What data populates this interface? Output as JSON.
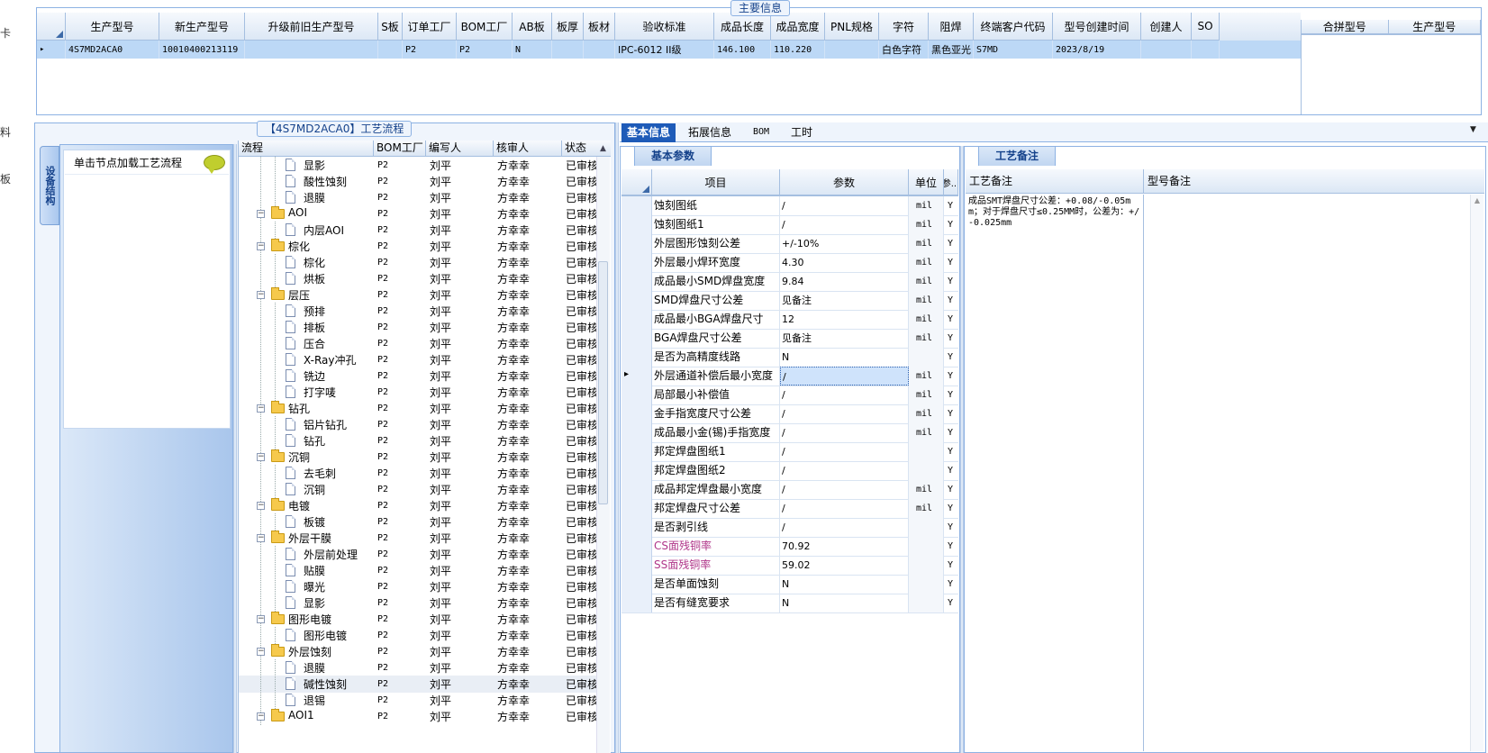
{
  "left_clipped": [
    "卡",
    "料",
    "板"
  ],
  "main": {
    "caption": "主要信息",
    "columns": [
      "生产型号",
      "新生产型号",
      "升级前旧生产型号",
      "S板",
      "订单工厂",
      "BOM工厂",
      "AB板",
      "板厚",
      "板材",
      "验收标准",
      "成品长度",
      "成品宽度",
      "PNL规格",
      "字符",
      "阻焊",
      "终端客户代码",
      "型号创建时间",
      "创建人",
      "SO"
    ],
    "row": {
      "marker": "▸",
      "cells": [
        "4S7MD2ACA0",
        "10010400213119",
        "",
        "",
        "P2",
        "P2",
        "N",
        "",
        "",
        "IPC-6012 II级",
        "146.100",
        "110.220",
        "",
        "白色字符",
        "黑色亚光",
        "S7MD",
        "2023/8/19",
        "",
        ""
      ]
    },
    "merge_columns": [
      "合拼型号",
      "生产型号"
    ]
  },
  "process": {
    "caption": "【4S7MD2ACA0】工艺流程",
    "side_tab": "设备结构",
    "side_item": "单击节点加载工艺流程",
    "columns": [
      "流程",
      "BOM工厂",
      "编写人",
      "核审人",
      "状态"
    ],
    "rows": [
      {
        "label": "显影",
        "level": 2,
        "type": "doc",
        "factory": "P2",
        "writer": "刘平",
        "reviewer": "方幸幸",
        "status": "已审核"
      },
      {
        "label": "酸性蚀刻",
        "level": 2,
        "type": "doc",
        "factory": "P2",
        "writer": "刘平",
        "reviewer": "方幸幸",
        "status": "已审核"
      },
      {
        "label": "退膜",
        "level": 2,
        "type": "doc",
        "factory": "P2",
        "writer": "刘平",
        "reviewer": "方幸幸",
        "status": "已审核"
      },
      {
        "label": "AOI",
        "level": 1,
        "type": "folder",
        "factory": "P2",
        "writer": "刘平",
        "reviewer": "方幸幸",
        "status": "已审核"
      },
      {
        "label": "内层AOI",
        "level": 2,
        "type": "doc",
        "factory": "P2",
        "writer": "刘平",
        "reviewer": "方幸幸",
        "status": "已审核"
      },
      {
        "label": "棕化",
        "level": 1,
        "type": "folder",
        "factory": "P2",
        "writer": "刘平",
        "reviewer": "方幸幸",
        "status": "已审核"
      },
      {
        "label": "棕化",
        "level": 2,
        "type": "doc",
        "factory": "P2",
        "writer": "刘平",
        "reviewer": "方幸幸",
        "status": "已审核"
      },
      {
        "label": "烘板",
        "level": 2,
        "type": "doc",
        "factory": "P2",
        "writer": "刘平",
        "reviewer": "方幸幸",
        "status": "已审核"
      },
      {
        "label": "层压",
        "level": 1,
        "type": "folder",
        "factory": "P2",
        "writer": "刘平",
        "reviewer": "方幸幸",
        "status": "已审核"
      },
      {
        "label": "预排",
        "level": 2,
        "type": "doc",
        "factory": "P2",
        "writer": "刘平",
        "reviewer": "方幸幸",
        "status": "已审核"
      },
      {
        "label": "排板",
        "level": 2,
        "type": "doc",
        "factory": "P2",
        "writer": "刘平",
        "reviewer": "方幸幸",
        "status": "已审核"
      },
      {
        "label": "压合",
        "level": 2,
        "type": "doc",
        "factory": "P2",
        "writer": "刘平",
        "reviewer": "方幸幸",
        "status": "已审核"
      },
      {
        "label": "X-Ray冲孔",
        "level": 2,
        "type": "doc",
        "factory": "P2",
        "writer": "刘平",
        "reviewer": "方幸幸",
        "status": "已审核"
      },
      {
        "label": "铣边",
        "level": 2,
        "type": "doc",
        "factory": "P2",
        "writer": "刘平",
        "reviewer": "方幸幸",
        "status": "已审核"
      },
      {
        "label": "打字唛",
        "level": 2,
        "type": "doc",
        "factory": "P2",
        "writer": "刘平",
        "reviewer": "方幸幸",
        "status": "已审核"
      },
      {
        "label": "钻孔",
        "level": 1,
        "type": "folder",
        "factory": "P2",
        "writer": "刘平",
        "reviewer": "方幸幸",
        "status": "已审核"
      },
      {
        "label": "铝片钻孔",
        "level": 2,
        "type": "doc",
        "factory": "P2",
        "writer": "刘平",
        "reviewer": "方幸幸",
        "status": "已审核"
      },
      {
        "label": "钻孔",
        "level": 2,
        "type": "doc",
        "factory": "P2",
        "writer": "刘平",
        "reviewer": "方幸幸",
        "status": "已审核"
      },
      {
        "label": "沉铜",
        "level": 1,
        "type": "folder",
        "factory": "P2",
        "writer": "刘平",
        "reviewer": "方幸幸",
        "status": "已审核"
      },
      {
        "label": "去毛刺",
        "level": 2,
        "type": "doc",
        "factory": "P2",
        "writer": "刘平",
        "reviewer": "方幸幸",
        "status": "已审核"
      },
      {
        "label": "沉铜",
        "level": 2,
        "type": "doc",
        "factory": "P2",
        "writer": "刘平",
        "reviewer": "方幸幸",
        "status": "已审核"
      },
      {
        "label": "电镀",
        "level": 1,
        "type": "folder",
        "factory": "P2",
        "writer": "刘平",
        "reviewer": "方幸幸",
        "status": "已审核"
      },
      {
        "label": "板镀",
        "level": 2,
        "type": "doc",
        "factory": "P2",
        "writer": "刘平",
        "reviewer": "方幸幸",
        "status": "已审核"
      },
      {
        "label": "外层干膜",
        "level": 1,
        "type": "folder",
        "factory": "P2",
        "writer": "刘平",
        "reviewer": "方幸幸",
        "status": "已审核"
      },
      {
        "label": "外层前处理",
        "level": 2,
        "type": "doc",
        "factory": "P2",
        "writer": "刘平",
        "reviewer": "方幸幸",
        "status": "已审核"
      },
      {
        "label": "贴膜",
        "level": 2,
        "type": "doc",
        "factory": "P2",
        "writer": "刘平",
        "reviewer": "方幸幸",
        "status": "已审核"
      },
      {
        "label": "曝光",
        "level": 2,
        "type": "doc",
        "factory": "P2",
        "writer": "刘平",
        "reviewer": "方幸幸",
        "status": "已审核"
      },
      {
        "label": "显影",
        "level": 2,
        "type": "doc",
        "factory": "P2",
        "writer": "刘平",
        "reviewer": "方幸幸",
        "status": "已审核"
      },
      {
        "label": "图形电镀",
        "level": 1,
        "type": "folder",
        "factory": "P2",
        "writer": "刘平",
        "reviewer": "方幸幸",
        "status": "已审核"
      },
      {
        "label": "图形电镀",
        "level": 2,
        "type": "doc",
        "factory": "P2",
        "writer": "刘平",
        "reviewer": "方幸幸",
        "status": "已审核"
      },
      {
        "label": "外层蚀刻",
        "level": 1,
        "type": "folder",
        "factory": "P2",
        "writer": "刘平",
        "reviewer": "方幸幸",
        "status": "已审核"
      },
      {
        "label": "退膜",
        "level": 2,
        "type": "doc",
        "factory": "P2",
        "writer": "刘平",
        "reviewer": "方幸幸",
        "status": "已审核"
      },
      {
        "label": "碱性蚀刻",
        "level": 2,
        "type": "doc",
        "factory": "P2",
        "writer": "刘平",
        "reviewer": "方幸幸",
        "status": "已审核",
        "selected": true
      },
      {
        "label": "退锡",
        "level": 2,
        "type": "doc",
        "factory": "P2",
        "writer": "刘平",
        "reviewer": "方幸幸",
        "status": "已审核"
      },
      {
        "label": "AOI1",
        "level": 1,
        "type": "folder",
        "factory": "P2",
        "writer": "刘平",
        "reviewer": "方幸幸",
        "status": "已审核"
      }
    ]
  },
  "tabs": [
    "基本信息",
    "拓展信息",
    "BOM",
    "工时"
  ],
  "basic": {
    "caption": "基本参数",
    "columns": [
      "项目",
      "参数",
      "单位",
      "参..."
    ],
    "rows": [
      {
        "item": "蚀刻图纸",
        "value": "/",
        "unit": "mil",
        "flag": "Y"
      },
      {
        "item": "蚀刻图纸1",
        "value": "/",
        "unit": "mil",
        "flag": "Y"
      },
      {
        "item": "外层图形蚀刻公差",
        "value": "+/-10%",
        "unit": "mil",
        "flag": "Y"
      },
      {
        "item": "外层最小焊环宽度",
        "value": "4.30",
        "unit": "mil",
        "flag": "Y"
      },
      {
        "item": "成品最小SMD焊盘宽度",
        "value": "9.84",
        "unit": "mil",
        "flag": "Y"
      },
      {
        "item": "SMD焊盘尺寸公差",
        "value": "见备注",
        "unit": "mil",
        "flag": "Y"
      },
      {
        "item": "成品最小BGA焊盘尺寸",
        "value": "12",
        "unit": "mil",
        "flag": "Y"
      },
      {
        "item": "BGA焊盘尺寸公差",
        "value": "见备注",
        "unit": "mil",
        "flag": "Y"
      },
      {
        "item": "是否为高精度线路",
        "value": "N",
        "unit": "",
        "flag": "Y"
      },
      {
        "item": "外层通道补偿后最小宽度",
        "value": "/",
        "unit": "mil",
        "flag": "Y",
        "current": true
      },
      {
        "item": "局部最小补偿值",
        "value": "/",
        "unit": "mil",
        "flag": "Y"
      },
      {
        "item": "金手指宽度尺寸公差",
        "value": "/",
        "unit": "mil",
        "flag": "Y"
      },
      {
        "item": "成品最小金(锡)手指宽度",
        "value": "/",
        "unit": "mil",
        "flag": "Y"
      },
      {
        "item": "邦定焊盘图纸1",
        "value": "/",
        "unit": "",
        "flag": "Y"
      },
      {
        "item": "邦定焊盘图纸2",
        "value": "/",
        "unit": "",
        "flag": "Y"
      },
      {
        "item": "成品邦定焊盘最小宽度",
        "value": "/",
        "unit": "mil",
        "flag": "Y"
      },
      {
        "item": "邦定焊盘尺寸公差",
        "value": "/",
        "unit": "mil",
        "flag": "Y"
      },
      {
        "item": "是否剥引线",
        "value": "/",
        "unit": "",
        "flag": "Y"
      },
      {
        "item": "CS面残铜率",
        "value": "70.92",
        "unit": "",
        "flag": "Y",
        "highlight": true
      },
      {
        "item": "SS面残铜率",
        "value": "59.02",
        "unit": "",
        "flag": "Y",
        "highlight": true
      },
      {
        "item": "是否单面蚀刻",
        "value": "N",
        "unit": "",
        "flag": "Y"
      },
      {
        "item": "是否有缝宽要求",
        "value": "N",
        "unit": "",
        "flag": "Y"
      }
    ]
  },
  "notes": {
    "caption": "工艺备注",
    "columns": [
      "工艺备注",
      "型号备注"
    ],
    "process_note": "成品SMT焊盘尺寸公差：+0.08/-0.05mm；对于焊盘尺寸≤0.25MM时，公差为：+/-0.025mm",
    "model_note": ""
  },
  "colors": {
    "accent": "#1e5bb8",
    "border": "#8db2e3",
    "selected_row": "#bcd8f6",
    "highlight_text": "#b0378a"
  }
}
